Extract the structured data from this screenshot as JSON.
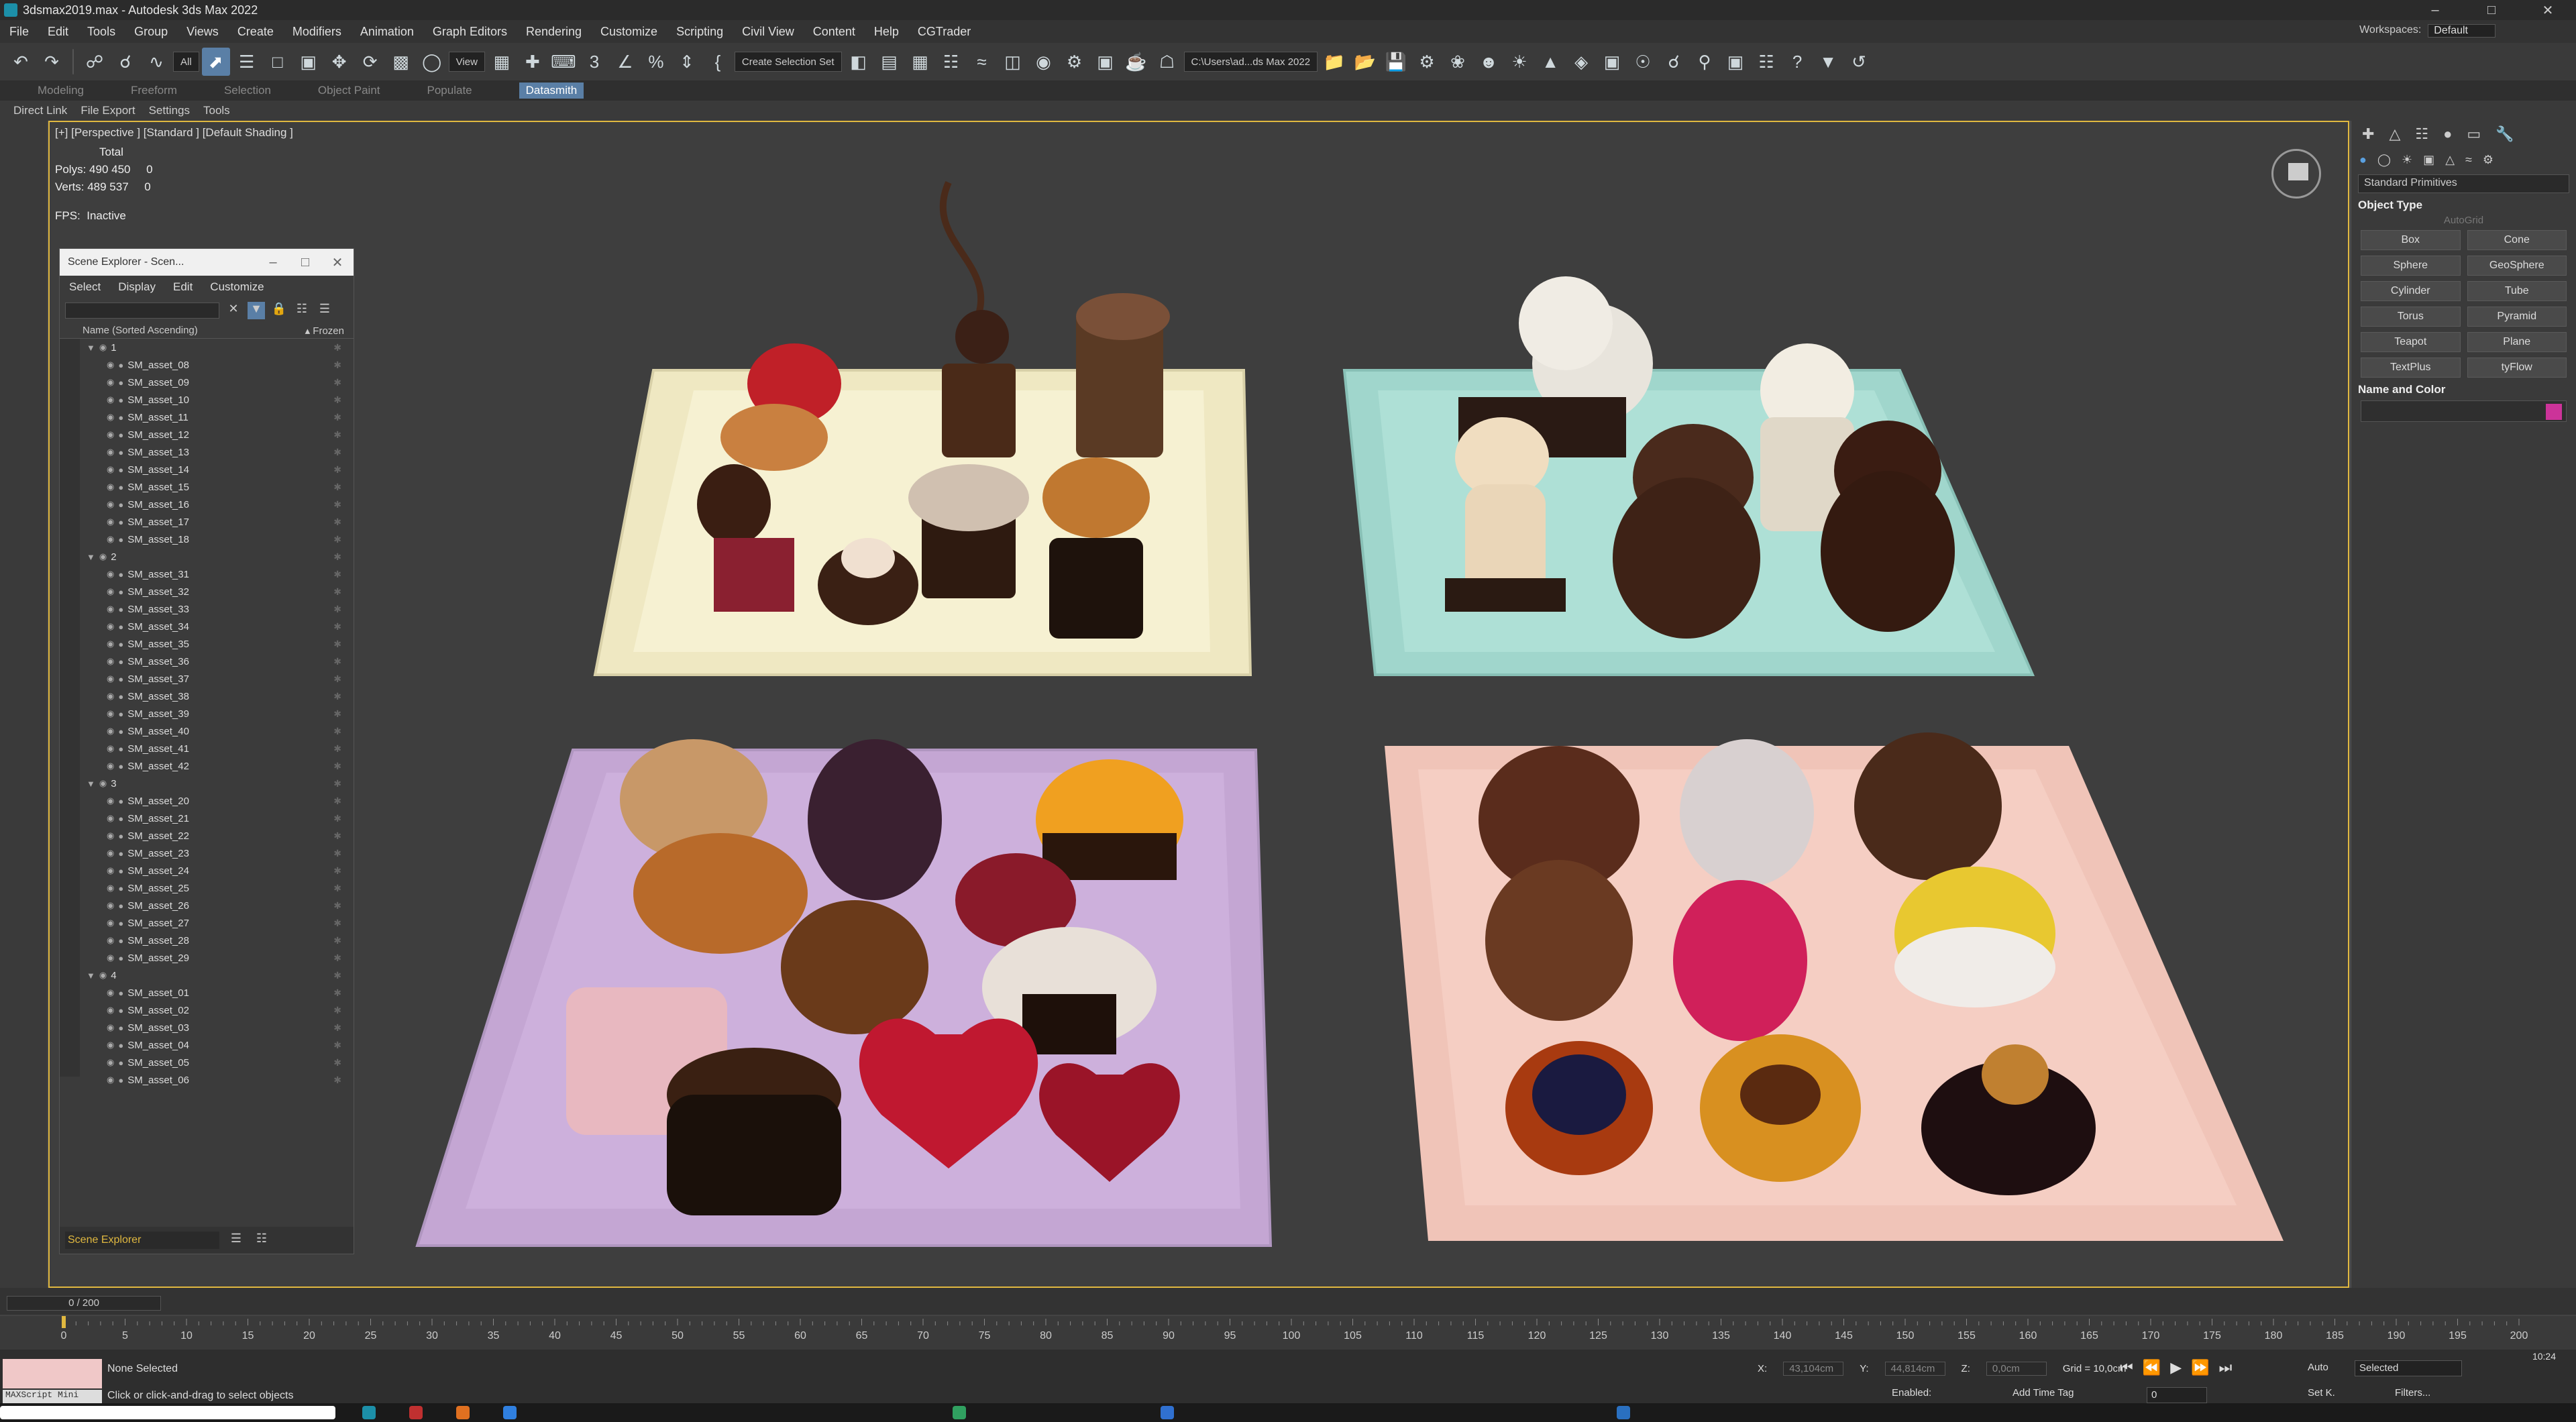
{
  "app": {
    "title": "3dsmax2019.max - Autodesk 3ds Max 2022",
    "workspaces_label": "Workspaces:",
    "workspaces_value": "Default"
  },
  "menu": [
    "File",
    "Edit",
    "Tools",
    "Group",
    "Views",
    "Create",
    "Modifiers",
    "Animation",
    "Graph Editors",
    "Rendering",
    "Customize",
    "Scripting",
    "Civil View",
    "Content",
    "Help",
    "CGTrader"
  ],
  "toolbar": {
    "filter_value": "All",
    "refcoord_value": "View",
    "selection_set": "Create Selection Set",
    "path_value": "C:\\Users\\ad...ds Max 2022"
  },
  "ribbon": {
    "tabs": [
      "Modeling",
      "Freeform",
      "Selection",
      "Object Paint",
      "Populate",
      "Datasmith"
    ],
    "active": "Datasmith",
    "sub": [
      "Direct Link",
      "File Export",
      "Settings",
      "Tools"
    ]
  },
  "viewport": {
    "label": "[+] [Perspective ] [Standard ] [Default Shading ]",
    "total_label": "Total",
    "polys_label": "Polys:",
    "polys_total": "490 450",
    "polys_sel": "0",
    "verts_label": "Verts:",
    "verts_total": "489 537",
    "verts_sel": "0",
    "fps_label": "FPS:",
    "fps_value": "Inactive"
  },
  "scene_explorer": {
    "title": "Scene Explorer - Scen...",
    "menu": [
      "Select",
      "Display",
      "Edit",
      "Customize"
    ],
    "col_name": "Name (Sorted Ascending)",
    "col_frozen": "▴ Frozen",
    "groups": [
      {
        "name": "1",
        "assets": [
          "SM_asset_08",
          "SM_asset_09",
          "SM_asset_10",
          "SM_asset_11",
          "SM_asset_12",
          "SM_asset_13",
          "SM_asset_14",
          "SM_asset_15",
          "SM_asset_16",
          "SM_asset_17",
          "SM_asset_18"
        ]
      },
      {
        "name": "2",
        "assets": [
          "SM_asset_31",
          "SM_asset_32",
          "SM_asset_33",
          "SM_asset_34",
          "SM_asset_35",
          "SM_asset_36",
          "SM_asset_37",
          "SM_asset_38",
          "SM_asset_39",
          "SM_asset_40",
          "SM_asset_41",
          "SM_asset_42"
        ]
      },
      {
        "name": "3",
        "assets": [
          "SM_asset_20",
          "SM_asset_21",
          "SM_asset_22",
          "SM_asset_23",
          "SM_asset_24",
          "SM_asset_25",
          "SM_asset_26",
          "SM_asset_27",
          "SM_asset_28",
          "SM_asset_29"
        ]
      },
      {
        "name": "4",
        "assets": [
          "SM_asset_01",
          "SM_asset_02",
          "SM_asset_03",
          "SM_asset_04",
          "SM_asset_05",
          "SM_asset_06"
        ]
      }
    ],
    "footer_label": "Scene Explorer"
  },
  "command_panel": {
    "category": "Standard Primitives",
    "rollout_object_type": "Object Type",
    "autogrid": "AutoGrid",
    "buttons": [
      "Box",
      "Cone",
      "Sphere",
      "GeoSphere",
      "Cylinder",
      "Tube",
      "Torus",
      "Pyramid",
      "Teapot",
      "Plane",
      "TextPlus",
      "tyFlow"
    ],
    "rollout_name_color": "Name and Color",
    "color_swatch": "#cc3399"
  },
  "timeline": {
    "frame_slider": "0 / 200",
    "ticks": [
      "0",
      "5",
      "10",
      "15",
      "20",
      "25",
      "30",
      "35",
      "40",
      "45",
      "50",
      "55",
      "60",
      "65",
      "70",
      "75",
      "80",
      "85",
      "90",
      "95",
      "100",
      "105",
      "110",
      "115",
      "120",
      "125",
      "130",
      "135",
      "140",
      "145",
      "150",
      "155",
      "160",
      "165",
      "170",
      "175",
      "180",
      "185",
      "190",
      "195",
      "200"
    ]
  },
  "status": {
    "maxscript": "MAXScript Mini",
    "selection": "None Selected",
    "prompt": "Click or click-and-drag to select objects",
    "x_label": "X:",
    "x_value": "43,104cm",
    "y_label": "Y:",
    "y_value": "44,814cm",
    "z_label": "Z:",
    "z_value": "0,0cm",
    "grid": "Grid = 10,0cm",
    "enabled": "Enabled:",
    "add_time_tag": "Add Time Tag",
    "auto": "Auto",
    "set_key": "Set K.",
    "selected": "Selected",
    "filters": "Filters...",
    "frame": "0",
    "clock": "10:24"
  },
  "colors": {
    "accent": "#5a7fa6",
    "viewport_border": "#e0b840",
    "plate_cream": "#f2edc8",
    "plate_teal": "#a8ddd2",
    "plate_lilac": "#c7a8d6",
    "plate_pink": "#f2c8bd"
  }
}
